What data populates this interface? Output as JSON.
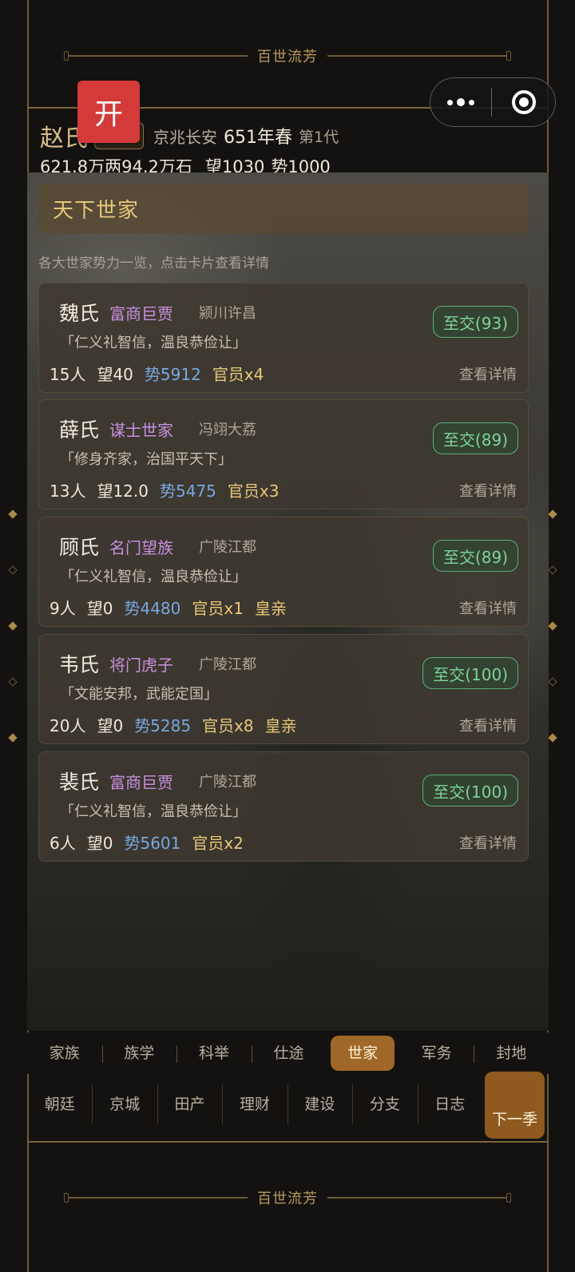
{
  "app": {
    "banner_title": "百世流芳",
    "footer_banner_title": "百世流芳",
    "open_badge": "开"
  },
  "header": {
    "clan_name": "赵氏",
    "clan_tag": "",
    "location": "京兆长安",
    "date": "651年春",
    "generation": "第1代",
    "money": "621.8万两",
    "grain": "94.2万石",
    "prestige": "望1030",
    "power": "势1000"
  },
  "panel": {
    "title": "天下世家",
    "hint": "各大世家势力一览，点击卡片查看详情"
  },
  "families": [
    {
      "name": "魏氏",
      "type": "富商巨贾",
      "place": "颍川许昌",
      "motto": "「仁义礼智信，温良恭俭让」",
      "people": "15人",
      "prestige": "望40",
      "power": "势5912",
      "officials": "官员x4",
      "royal": "",
      "relation": "至交(93)",
      "detail": "查看详情"
    },
    {
      "name": "薛氏",
      "type": "谋士世家",
      "place": "冯翊大荔",
      "motto": "「修身齐家，治国平天下」",
      "people": "13人",
      "prestige": "望12.0",
      "power": "势5475",
      "officials": "官员x3",
      "royal": "",
      "relation": "至交(89)",
      "detail": "查看详情"
    },
    {
      "name": "顾氏",
      "type": "名门望族",
      "place": "广陵江都",
      "motto": "「仁义礼智信，温良恭俭让」",
      "people": "9人",
      "prestige": "望0",
      "power": "势4480",
      "officials": "官员x1",
      "royal": "皇亲",
      "relation": "至交(89)",
      "detail": "查看详情"
    },
    {
      "name": "韦氏",
      "type": "将门虎子",
      "place": "广陵江都",
      "motto": "「文能安邦，武能定国」",
      "people": "20人",
      "prestige": "望0",
      "power": "势5285",
      "officials": "官员x8",
      "royal": "皇亲",
      "relation": "至交(100)",
      "detail": "查看详情"
    },
    {
      "name": "裴氏",
      "type": "富商巨贾",
      "place": "广陵江都",
      "motto": "「仁义礼智信，温良恭俭让」",
      "people": "6人",
      "prestige": "望0",
      "power": "势5601",
      "officials": "官员x2",
      "royal": "",
      "relation": "至交(100)",
      "detail": "查看详情"
    }
  ],
  "tabs_primary": [
    "家族",
    "族学",
    "科举",
    "仕途",
    "世家",
    "军务",
    "封地"
  ],
  "tabs_primary_active": "世家",
  "tabs_secondary": [
    "朝廷",
    "京城",
    "田产",
    "理财",
    "建设",
    "分支",
    "日志"
  ],
  "next_season": "下一季",
  "colors": {
    "accent_gold": "#e8c87a",
    "active_tab": "#a06828",
    "relation_green": "#7ed49a",
    "power_blue": "#78a8e0",
    "type_purple": "#c890e0",
    "open_badge_red": "#d43a3a"
  }
}
